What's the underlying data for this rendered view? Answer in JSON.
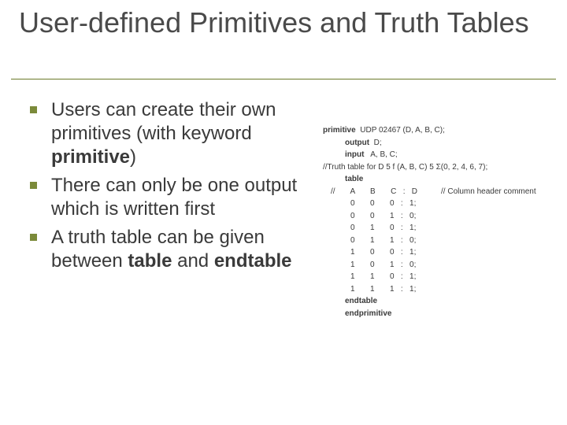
{
  "title": "User-defined Primitives and Truth Tables",
  "bullets": [
    {
      "pre": "Users can create their own primitives (with keyword ",
      "bold": "primitive",
      "post": ")"
    },
    {
      "pre": "There can only be one output which is written first",
      "bold": "",
      "post": ""
    },
    {
      "pre": "A truth table can be given between ",
      "bold": "table",
      "post": " and ",
      "bold2": "endtable"
    }
  ],
  "code": {
    "line1_kw": "primitive",
    "line1_rest": "  UDP 02467 (D, A, B, C);",
    "line2_kw": "output",
    "line2_rest": "  D;",
    "line3_kw": "input",
    "line3_rest": "   A, B, C;",
    "comment1": "//Truth table for D 5 f (A, B, C) 5 Σ(0, 2, 4, 6, 7);",
    "table_kw": "table",
    "header": "//       A       B       C   :   D",
    "header_comment": "// Column header comment",
    "rows": [
      "         0       0       0   :   1;",
      "         0       0       1   :   0;",
      "         0       1       0   :   1;",
      "         0       1       1   :   0;",
      "         1       0       0   :   1;",
      "         1       0       1   :   0;",
      "         1       1       0   :   1;",
      "         1       1       1   :   1;"
    ],
    "endtable_kw": "endtable",
    "endprimitive_kw": "endprimitive"
  }
}
